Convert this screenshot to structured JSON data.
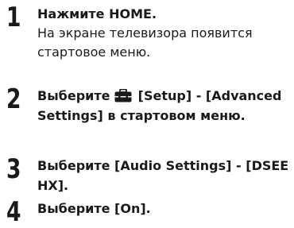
{
  "steps": [
    {
      "number": "1",
      "instruction": "Нажмите HOME.",
      "note": "На экране телевизора появится стартовое меню."
    },
    {
      "number": "2",
      "instruction_before_icon": "Выберите",
      "icon": "toolbox-icon",
      "instruction_after_icon": "[Setup] - [Advanced Settings] в стартовом меню."
    },
    {
      "number": "3",
      "instruction": "Выберите [Audio Settings] - [DSEE HX]."
    },
    {
      "number": "4",
      "instruction": "Выберите [On]."
    }
  ]
}
